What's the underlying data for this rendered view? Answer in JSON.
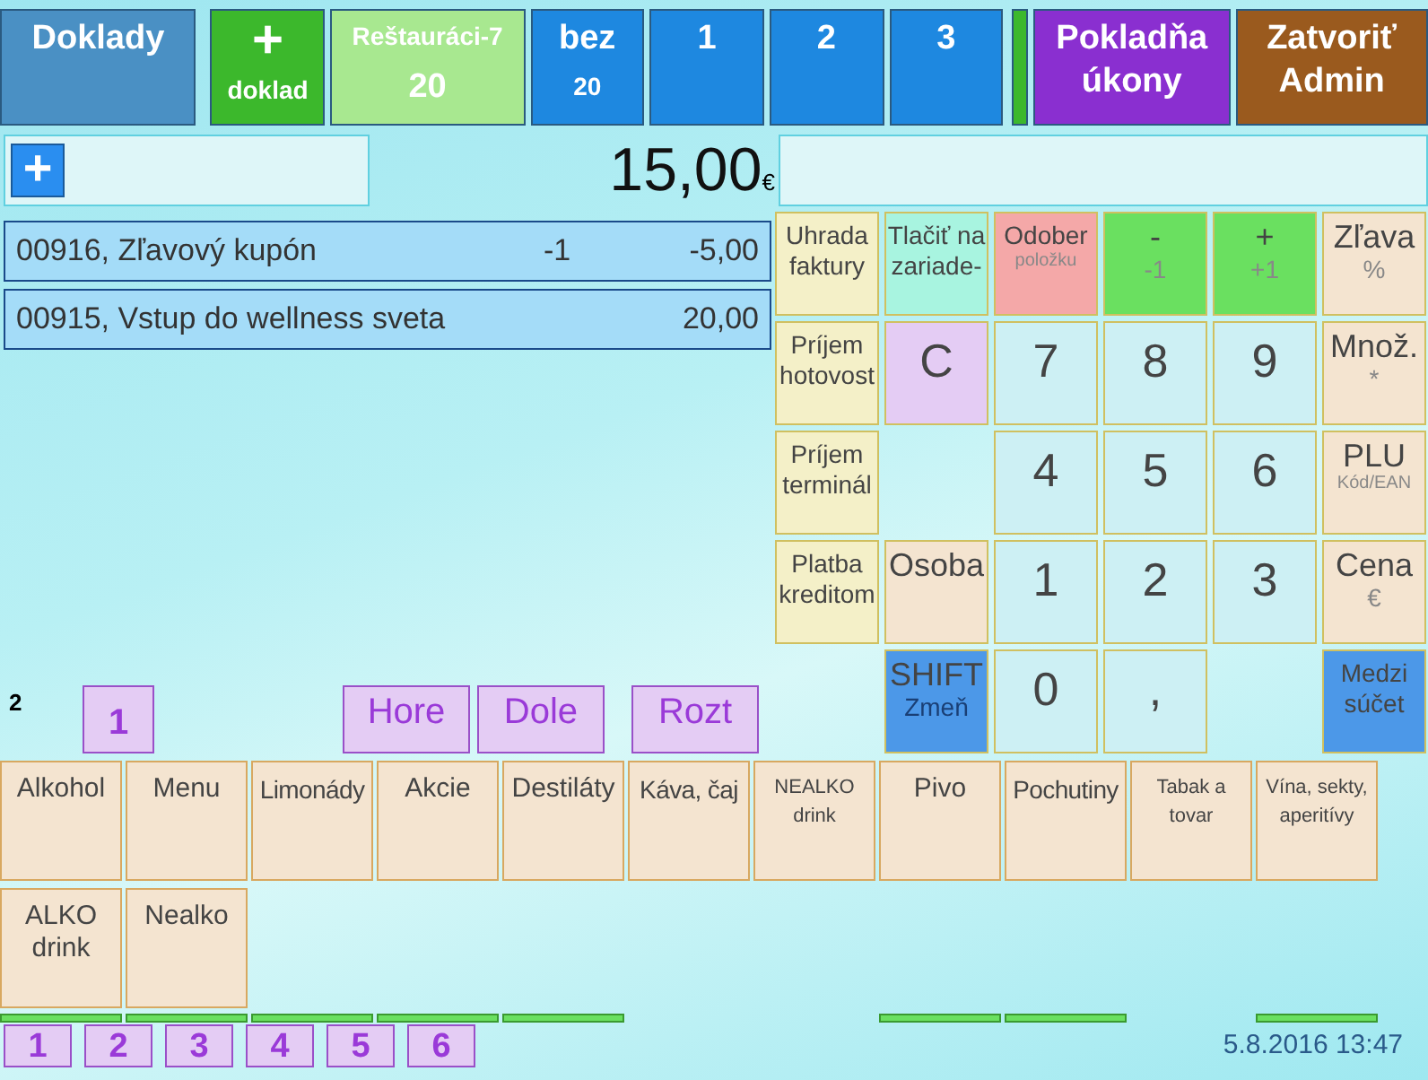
{
  "top_bar": [
    {
      "label": "Doklady",
      "color": "#4a90c4"
    },
    {
      "label": "+",
      "sub": "doklad",
      "color": "#3cb82c"
    },
    {
      "label": "Reštauráci-7",
      "sub": "20",
      "color": "#a8e890"
    },
    {
      "label": "bez",
      "sub": "20",
      "color": "#1e88e0"
    },
    {
      "label": "1",
      "color": "#1e88e0"
    },
    {
      "label": "2",
      "color": "#1e88e0"
    },
    {
      "label": "3",
      "color": "#1e88e0"
    },
    {
      "color": "#3cb82c"
    },
    {
      "label": "Pokladňa úkony",
      "color": "#8a2fd0"
    },
    {
      "label": "Zatvoriť Admin",
      "color": "#9a5a1e"
    }
  ],
  "add_button": "+",
  "total": {
    "amount": "15,00",
    "currency": "€"
  },
  "items": [
    {
      "name": "00916, Zľavový kupón",
      "qty": "-1",
      "price": "-5,00"
    },
    {
      "name": "00915, Vstup do wellness sveta",
      "price": "20,00"
    }
  ],
  "keypad": [
    {
      "kind": "key",
      "label": "Uhrada faktury",
      "color": "#f4f0c8"
    },
    {
      "kind": "key",
      "label": "Tlačiť na zariade-",
      "color": "#a8f4e0"
    },
    {
      "kind": "key",
      "label": "Odober",
      "sub": "položku",
      "color": "#f4a8a8"
    },
    {
      "kind": "key",
      "label": "-",
      "sub": "-1",
      "color": "#6ae060"
    },
    {
      "kind": "key",
      "label": "+",
      "sub": "+1",
      "color": "#6ae060"
    },
    {
      "kind": "key",
      "label": "Zľava",
      "sub": "%",
      "color": "#f4e4d0"
    },
    {
      "kind": "key",
      "label": "Príjem hotovost",
      "color": "#f4f0c8"
    },
    {
      "kind": "key",
      "label": "C",
      "color": "#e4ccf4"
    },
    {
      "kind": "key",
      "label": "7",
      "color": "#cdf0f4"
    },
    {
      "kind": "key",
      "label": "8",
      "color": "#cdf0f4"
    },
    {
      "kind": "key",
      "label": "9",
      "color": "#cdf0f4"
    },
    {
      "kind": "key",
      "label": "Množ.",
      "sub": "*",
      "color": "#f4e4d0"
    },
    {
      "kind": "key",
      "label": "Príjem terminál",
      "color": "#f4f0c8"
    },
    {
      "kind": "blank"
    },
    {
      "kind": "key",
      "label": "4",
      "color": "#cdf0f4"
    },
    {
      "kind": "key",
      "label": "5",
      "color": "#cdf0f4"
    },
    {
      "kind": "key",
      "label": "6",
      "color": "#cdf0f4"
    },
    {
      "kind": "key",
      "label": "PLU",
      "sub": "Kód/EAN",
      "color": "#f4e4d0"
    },
    {
      "kind": "key",
      "label": "Platba kreditom",
      "color": "#f4f0c8"
    },
    {
      "kind": "key",
      "label": "Osoba",
      "color": "#f4e4d0"
    },
    {
      "kind": "key",
      "label": "1",
      "color": "#cdf0f4"
    },
    {
      "kind": "key",
      "label": "2",
      "color": "#cdf0f4"
    },
    {
      "kind": "key",
      "label": "3",
      "color": "#cdf0f4"
    },
    {
      "kind": "key",
      "label": "Cena",
      "sub": "€",
      "color": "#f4e4d0"
    },
    {
      "kind": "blank"
    },
    {
      "kind": "key",
      "label": "SHIFT",
      "sub": "Zmeň",
      "color": "#4c98e8"
    },
    {
      "kind": "key",
      "label": "0",
      "color": "#cdf0f4"
    },
    {
      "kind": "key",
      "label": ",",
      "color": "#cdf0f4"
    },
    {
      "kind": "blank"
    },
    {
      "kind": "key",
      "label": "Medzi súčet",
      "color": "#4c98e8"
    }
  ],
  "pager": {
    "page_count": "2",
    "page": "1",
    "buttons": [
      "Hore",
      "Dole",
      "Rozt"
    ]
  },
  "categories": [
    "Alkohol",
    "Menu",
    "Limonády",
    "Akcie",
    "Destiláty",
    "Káva, čaj",
    "NEALKO drink",
    "Pivo",
    "Pochutiny",
    "Tabak a tovar",
    "Vína, sekty, aperitívy",
    "ALKO drink",
    "Nealko"
  ],
  "next_row": [
    {
      "shown": true
    },
    {
      "shown": true
    },
    {
      "shown": true
    },
    {
      "shown": true
    },
    {
      "shown": true
    },
    {
      "shown": false
    },
    {
      "shown": false
    },
    {
      "shown": true
    },
    {
      "shown": true
    },
    {
      "shown": false
    },
    {
      "shown": true
    }
  ],
  "bottom_tabs": [
    "1",
    "2",
    "3",
    "4",
    "5",
    "6"
  ],
  "datetime": "5.8.2016 13:47"
}
